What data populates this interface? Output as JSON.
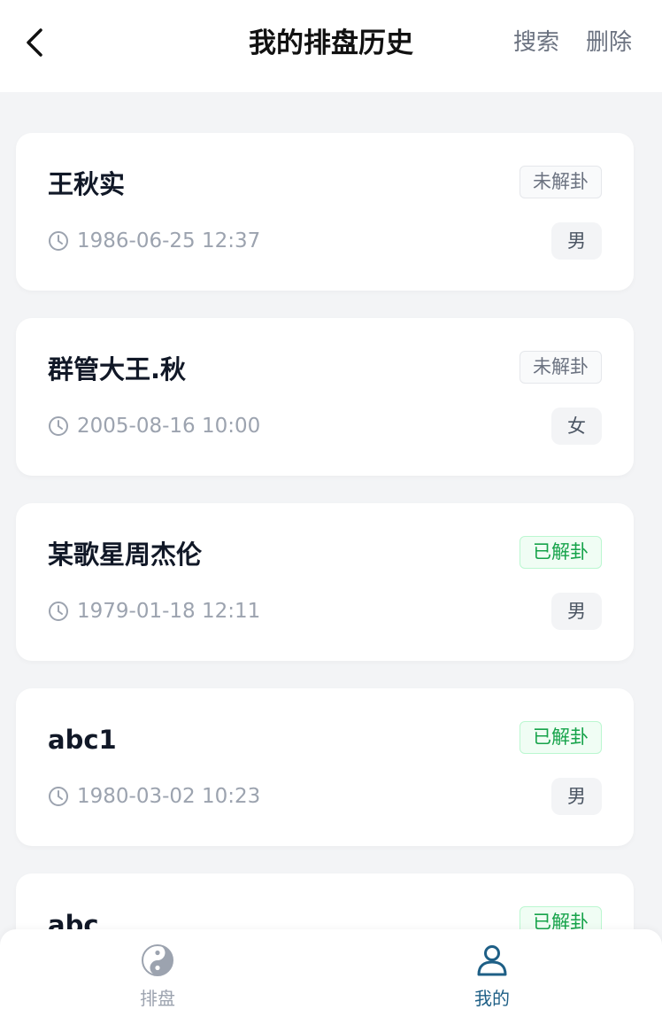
{
  "header": {
    "title": "我的排盘历史",
    "search_label": "搜索",
    "delete_label": "删除"
  },
  "records": [
    {
      "name": "王秋实",
      "status": "未解卦",
      "datetime": "1986-06-25 12:37",
      "gender": "男"
    },
    {
      "name": "群管大王.秋",
      "status": "未解卦",
      "datetime": "2005-08-16 10:00",
      "gender": "女"
    },
    {
      "name": "某歌星周杰伦",
      "status": "已解卦",
      "datetime": "1979-01-18 12:11",
      "gender": "男"
    },
    {
      "name": "abc1",
      "status": "已解卦",
      "datetime": "1980-03-02 10:23",
      "gender": "男"
    },
    {
      "name": "abc",
      "status": "已解卦",
      "datetime": "",
      "gender": ""
    }
  ],
  "tabbar": {
    "items": [
      {
        "label": "排盘",
        "icon": "yin-yang-icon",
        "active": false
      },
      {
        "label": "我的",
        "icon": "user-icon",
        "active": true
      }
    ]
  },
  "colors": {
    "accent": "#1e5f86",
    "pending_text": "#6b7280",
    "done_text": "#16a34a",
    "background": "#f3f4f6"
  }
}
